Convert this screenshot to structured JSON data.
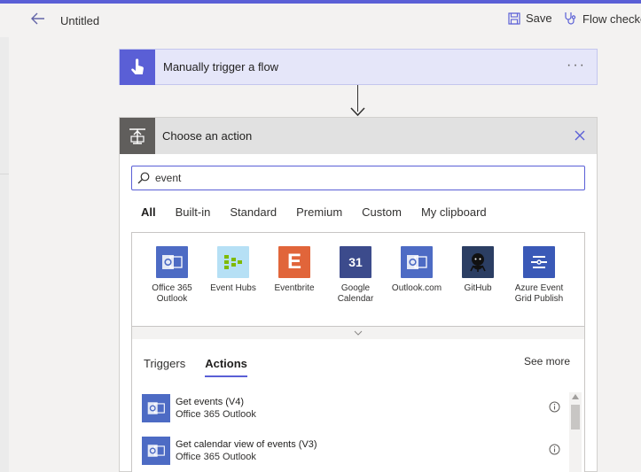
{
  "header": {
    "title": "Untitled",
    "save_label": "Save",
    "checker_label": "Flow checker"
  },
  "trigger": {
    "label": "Manually trigger a flow",
    "more": "···"
  },
  "action": {
    "title": "Choose an action",
    "search_value": "event",
    "tabs": [
      {
        "label": "All",
        "active": true
      },
      {
        "label": "Built-in"
      },
      {
        "label": "Standard"
      },
      {
        "label": "Premium"
      },
      {
        "label": "Custom"
      },
      {
        "label": "My clipboard"
      }
    ],
    "connectors": [
      {
        "name": "Office 365 Outlook",
        "color": "#4d6bc4",
        "icon": "outlook-icon"
      },
      {
        "name": "Event Hubs",
        "color": "#b6e0f5",
        "icon": "event-hubs-icon"
      },
      {
        "name": "Eventbrite",
        "color": "#e1653a",
        "icon": "eventbrite-icon",
        "glyph": "E"
      },
      {
        "name": "Google Calendar",
        "color": "#3c4b8c",
        "icon": "google-calendar-icon",
        "glyph": "31"
      },
      {
        "name": "Outlook.com",
        "color": "#4d6bc4",
        "icon": "outlook-icon"
      },
      {
        "name": "GitHub",
        "color": "#2b3e63",
        "icon": "github-icon"
      },
      {
        "name": "Azure Event Grid Publish",
        "color": "#3a59b7",
        "icon": "event-grid-icon"
      }
    ],
    "subtabs": [
      {
        "label": "Triggers"
      },
      {
        "label": "Actions",
        "active": true
      }
    ],
    "see_more": "See more",
    "items": [
      {
        "title": "Get events (V4)",
        "subtitle": "Office 365 Outlook"
      },
      {
        "title": "Get calendar view of events (V3)",
        "subtitle": "Office 365 Outlook"
      }
    ]
  }
}
